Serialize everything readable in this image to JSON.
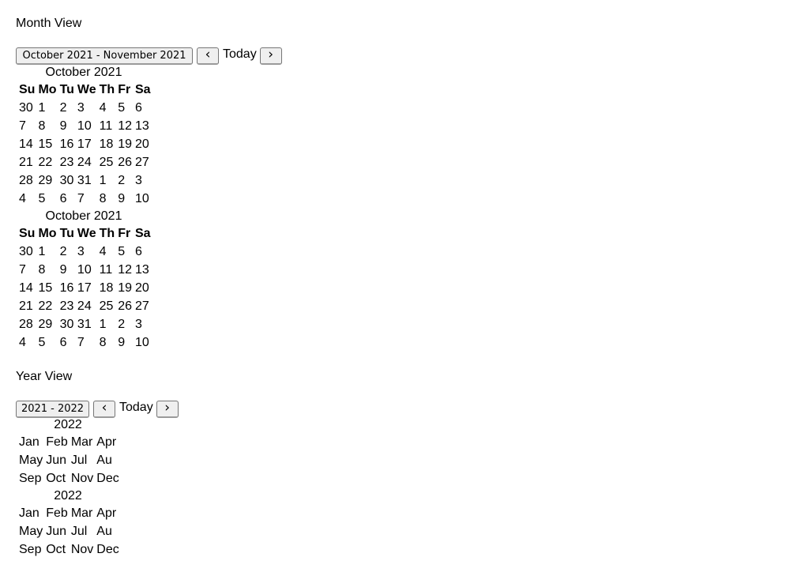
{
  "month_view": {
    "title": "Month View",
    "range_label": "October 2021 - November 2021",
    "prev_icon": "chevron-left-icon",
    "today_label": "Today",
    "next_icon": "chevron-right-icon",
    "calendars": [
      {
        "caption": "October 2021",
        "weekdays": [
          "Su",
          "Mo",
          "Tu",
          "We",
          "Th",
          "Fr",
          "Sa"
        ],
        "weeks": [
          [
            "30",
            "1",
            "2",
            "3",
            "4",
            "5",
            "6"
          ],
          [
            "7",
            "8",
            "9",
            "10",
            "11",
            "12",
            "13"
          ],
          [
            "14",
            "15",
            "16",
            "17",
            "18",
            "19",
            "20"
          ],
          [
            "21",
            "22",
            "23",
            "24",
            "25",
            "26",
            "27"
          ],
          [
            "28",
            "29",
            "30",
            "31",
            "1",
            "2",
            "3"
          ],
          [
            "4",
            "5",
            "6",
            "7",
            "8",
            "9",
            "10"
          ]
        ]
      },
      {
        "caption": "October 2021",
        "weekdays": [
          "Su",
          "Mo",
          "Tu",
          "We",
          "Th",
          "Fr",
          "Sa"
        ],
        "weeks": [
          [
            "30",
            "1",
            "2",
            "3",
            "4",
            "5",
            "6"
          ],
          [
            "7",
            "8",
            "9",
            "10",
            "11",
            "12",
            "13"
          ],
          [
            "14",
            "15",
            "16",
            "17",
            "18",
            "19",
            "20"
          ],
          [
            "21",
            "22",
            "23",
            "24",
            "25",
            "26",
            "27"
          ],
          [
            "28",
            "29",
            "30",
            "31",
            "1",
            "2",
            "3"
          ],
          [
            "4",
            "5",
            "6",
            "7",
            "8",
            "9",
            "10"
          ]
        ]
      }
    ]
  },
  "year_view": {
    "title": "Year View",
    "range_label": "2021 - 2022",
    "prev_icon": "chevron-left-icon",
    "today_label": "Today",
    "next_icon": "chevron-right-icon",
    "calendars": [
      {
        "caption": "2022",
        "rows": [
          [
            "Jan",
            "Feb",
            "Mar",
            "Apr"
          ],
          [
            "May",
            "Jun",
            "Jul",
            "Au"
          ],
          [
            "Sep",
            "Oct",
            "Nov",
            "Dec"
          ]
        ]
      },
      {
        "caption": "2022",
        "rows": [
          [
            "Jan",
            "Feb",
            "Mar",
            "Apr"
          ],
          [
            "May",
            "Jun",
            "Jul",
            "Au"
          ],
          [
            "Sep",
            "Oct",
            "Nov",
            "Dec"
          ]
        ]
      }
    ]
  }
}
